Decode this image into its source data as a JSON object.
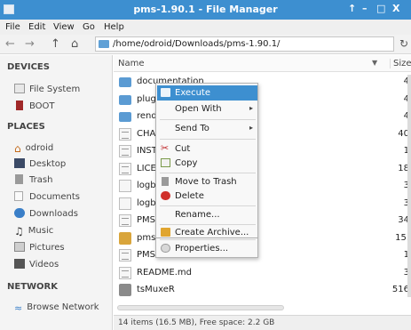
{
  "window": {
    "title": "pms-1.90.1 - File Manager",
    "controls": [
      "↑",
      "–",
      "□",
      "X"
    ]
  },
  "menubar": [
    "File",
    "Edit",
    "View",
    "Go",
    "Help"
  ],
  "toolbar": {
    "path": "/home/odroid/Downloads/pms-1.90.1/"
  },
  "sidebar": {
    "devices_header": "DEVICES",
    "devices": [
      "File System",
      "BOOT"
    ],
    "places_header": "PLACES",
    "places": [
      "odroid",
      "Desktop",
      "Trash",
      "Documents",
      "Downloads",
      "Music",
      "Pictures",
      "Videos"
    ],
    "network_header": "NETWORK",
    "network": [
      "Browse Network"
    ]
  },
  "filelist": {
    "col_name": "Name",
    "col_size": "Size",
    "rows": [
      {
        "name": "documentation",
        "size": "4",
        "type": "folder"
      },
      {
        "name": "plugi",
        "size": "4",
        "type": "folder"
      },
      {
        "name": "rende",
        "size": "4",
        "type": "folder"
      },
      {
        "name": "CHAN",
        "size": "40",
        "type": "doc"
      },
      {
        "name": "INSTA",
        "size": "1",
        "type": "doc"
      },
      {
        "name": "LICEN",
        "size": "18",
        "type": "doc"
      },
      {
        "name": "logba",
        "size": "3",
        "type": "html"
      },
      {
        "name": "logba",
        "size": "3",
        "type": "html"
      },
      {
        "name": "PMS.c",
        "size": "34",
        "type": "doc"
      },
      {
        "name": "pms.j",
        "size": "15.",
        "type": "jar"
      },
      {
        "name": "PMS.s",
        "size": "1",
        "type": "doc"
      },
      {
        "name": "README.md",
        "size": "3",
        "type": "doc"
      },
      {
        "name": "tsMuxeR",
        "size": "516",
        "type": "bin"
      }
    ]
  },
  "status": "14 items (16.5 MB), Free space: 2.2 GB",
  "context_menu": {
    "execute": "Execute",
    "open_with": "Open With",
    "send_to": "Send To",
    "cut": "Cut",
    "copy": "Copy",
    "move_to_trash": "Move to Trash",
    "delete": "Delete",
    "rename": "Rename...",
    "create_archive": "Create Archive...",
    "properties": "Properties..."
  },
  "colors": {
    "titlebar": "#3d8fd0",
    "selection": "#3d8fd0",
    "folder": "#5b9bd3"
  }
}
